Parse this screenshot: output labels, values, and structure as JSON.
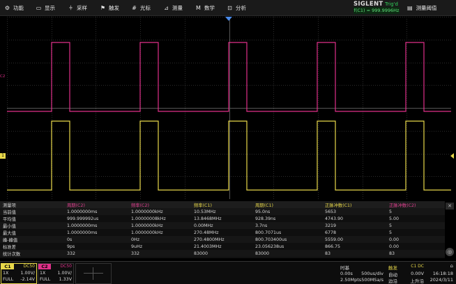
{
  "menu": {
    "items": [
      {
        "label": "功能",
        "icon": "gear-icon"
      },
      {
        "label": "显示",
        "icon": "display-icon"
      },
      {
        "label": "采样",
        "icon": "acquire-icon"
      },
      {
        "label": "触发",
        "icon": "trigger-flag-icon"
      },
      {
        "label": "光标",
        "icon": "cursor-icon"
      },
      {
        "label": "测量",
        "icon": "measure-icon"
      },
      {
        "label": "数学",
        "icon": "math-icon"
      },
      {
        "label": "分析",
        "icon": "analysis-icon"
      }
    ],
    "brand": "SIGLENT",
    "trig_status": "Trig'd",
    "freq_readout": "f(C1) = 999.9996Hz",
    "meas_threshold": "测量阈值"
  },
  "screen": {
    "ch2_marker": "C2",
    "ch1_marker": "1",
    "colors": {
      "ch1": "#e8d84a",
      "ch2": "#e0308a",
      "trigger": "#4a8ae8"
    }
  },
  "measurements": {
    "headers": [
      "测量项",
      "周期(C2)",
      "频率(C2)",
      "频率(C1)",
      "周期(C1)",
      "正脉冲数(C1)",
      "正脉冲数(C2)"
    ],
    "rows": [
      [
        "当前值",
        "1.0000000ms",
        "1.0000000kHz",
        "10.53MHz",
        "95.0ns",
        "5653",
        "5"
      ],
      [
        "平均值",
        "999.999992us",
        "1.00000008kHz",
        "13.8468MHz",
        "928.39ns",
        "4743.90",
        "5.00"
      ],
      [
        "最小值",
        "1.0000000ms",
        "1.0000000kHz",
        "0.00MHz",
        "3.7ns",
        "3219",
        "5"
      ],
      [
        "最大值",
        "1.0000000ms",
        "1.0000000kHz",
        "270.48MHz",
        "800.7071us",
        "6778",
        "5"
      ],
      [
        "峰-峰值",
        "0s",
        "0Hz",
        "270.4800MHz",
        "800.703400us",
        "5559.00",
        "0.00"
      ],
      [
        "标准差",
        "9ps",
        "9uHz",
        "21.4003MHz",
        "23.056238us",
        "866.75",
        "0.00"
      ],
      [
        "统计次数",
        "332",
        "332",
        "83000",
        "83000",
        "83",
        "83"
      ]
    ]
  },
  "status": {
    "ch1": {
      "tag": "C1",
      "coupling": "DC50",
      "probe": "1X",
      "scale": "1.00V/",
      "bw": "FULL",
      "offset": "-2.14V"
    },
    "ch2": {
      "tag": "C2",
      "coupling": "DC50",
      "probe": "1X",
      "scale": "1.00V/",
      "bw": "FULL",
      "offset": "1.33V"
    },
    "timebase": {
      "title": "时基",
      "delay": "0.00s",
      "scale": "500us/div",
      "memory": "2.50Mpts",
      "rate": "500MSa/s"
    },
    "trigger": {
      "title": "触发",
      "source": "C1 DC",
      "mode": "自动",
      "level": "0.00V",
      "type": "边沿",
      "slope": "上升沿"
    },
    "clock": {
      "time": "16:18:18",
      "date": "2024/3/11"
    }
  }
}
